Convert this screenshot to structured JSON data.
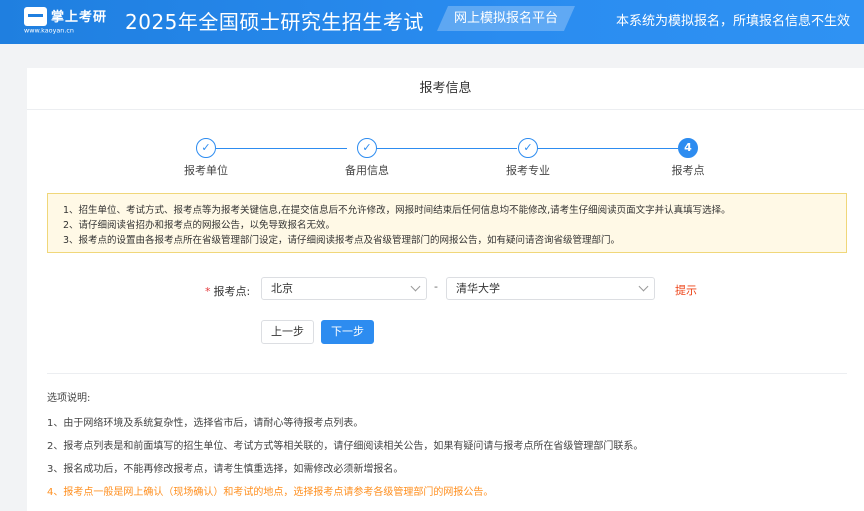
{
  "header": {
    "logo_name": "掌上考研",
    "logo_sub": "www.kaoyan.cn",
    "site_title": "2025年全国硕士研究生招生考试",
    "platform_tag": "网上模拟报名平台",
    "notice": "本系统为模拟报名，所填报名信息不生效",
    "colors": {
      "primary": "#2d8cf0",
      "header": "#1f7fe0"
    }
  },
  "card": {
    "title": "报考信息"
  },
  "steps": [
    {
      "label": "报考单位",
      "icon": "check-icon",
      "status": "done"
    },
    {
      "label": "备用信息",
      "icon": "check-icon",
      "status": "done"
    },
    {
      "label": "报考专业",
      "icon": "check-icon",
      "status": "done"
    },
    {
      "label": "报考点",
      "number": "4",
      "status": "current"
    }
  ],
  "warning": {
    "lines": [
      "1、招生单位、考试方式、报考点等为报考关键信息,在提交信息后不允许修改，网报时间结束后任何信息均不能修改,请考生仔细阅读页面文字并认真填写选择。",
      "2、请仔细阅读省招办和报考点的网报公告，以免导致报名无效。",
      "3、报考点的设置由各报考点所在省级管理部门设定，请仔细阅读报考点及省级管理部门的网报公告，如有疑问请咨询省级管理部门。"
    ],
    "colors": {
      "bg": "#fff9e6",
      "border": "#f0d77a"
    }
  },
  "form": {
    "required_mark": "*",
    "label": "报考点:",
    "province_value": "北京",
    "separator": "-",
    "site_value": "清华大学",
    "hint": "提示",
    "prev_button": "上一步",
    "next_button": "下一步"
  },
  "instructions": {
    "title": "选项说明:",
    "items": [
      "1、由于网络环境及系统复杂性，选择省市后，请耐心等待报考点列表。",
      "2、报考点列表是和前面填写的招生单位、考试方式等相关联的，请仔细阅读相关公告，如果有疑问请与报考点所在省级管理部门联系。",
      "3、报名成功后，不能再修改报考点，请考生慎重选择，如需修改必须新增报名。",
      "4、报考点一般是网上确认（现场确认）和考试的地点，选择报考点请参考各级管理部门的网报公告。"
    ],
    "highlight_color": "#ff8f1f"
  }
}
